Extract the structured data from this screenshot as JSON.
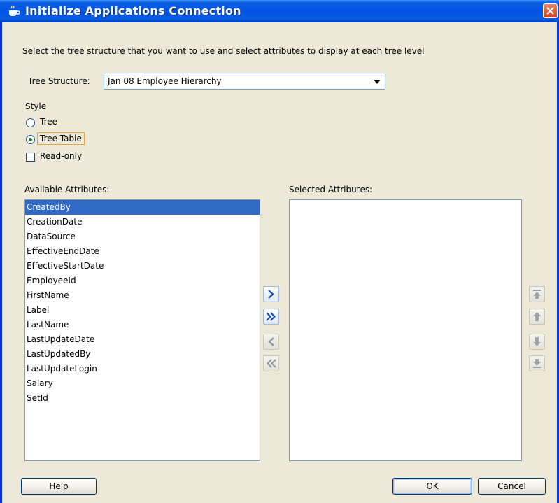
{
  "window": {
    "title": "Initialize Applications Connection"
  },
  "instruction": "Select the tree structure that you want to use and select attributes to display at each tree level",
  "tree_structure": {
    "label": "Tree Structure:",
    "value": "Jan 08 Employee Hierarchy"
  },
  "style": {
    "label": "Style",
    "options": [
      {
        "label": "Tree",
        "selected": false
      },
      {
        "label": "Tree Table",
        "selected": true
      }
    ],
    "read_only": {
      "label": "Read-only",
      "checked": false
    }
  },
  "available": {
    "label": "Available Attributes:",
    "items": [
      "CreatedBy",
      "CreationDate",
      "DataSource",
      "EffectiveEndDate",
      "EffectiveStartDate",
      "EmployeeId",
      "FirstName",
      "Label",
      "LastName",
      "LastUpdateDate",
      "LastUpdatedBy",
      "LastUpdateLogin",
      "Salary",
      "SetId"
    ],
    "selected_item": "CreatedBy"
  },
  "selected": {
    "label": "Selected Attributes:",
    "items": []
  },
  "buttons": {
    "help": "Help",
    "ok": "OK",
    "cancel": "Cancel"
  },
  "icons": {
    "title": "coffee-cup-icon",
    "move_right": "chevron-right-icon",
    "move_all_right": "double-chevron-right-icon",
    "move_left": "chevron-left-icon",
    "move_all_left": "double-chevron-left-icon",
    "top": "move-top-icon",
    "up": "move-up-icon",
    "down": "move-down-icon",
    "bottom": "move-bottom-icon"
  },
  "colors": {
    "titlebar": "#0054e3",
    "selection": "#316ac5",
    "dialog_bg": "#ece9d8"
  }
}
